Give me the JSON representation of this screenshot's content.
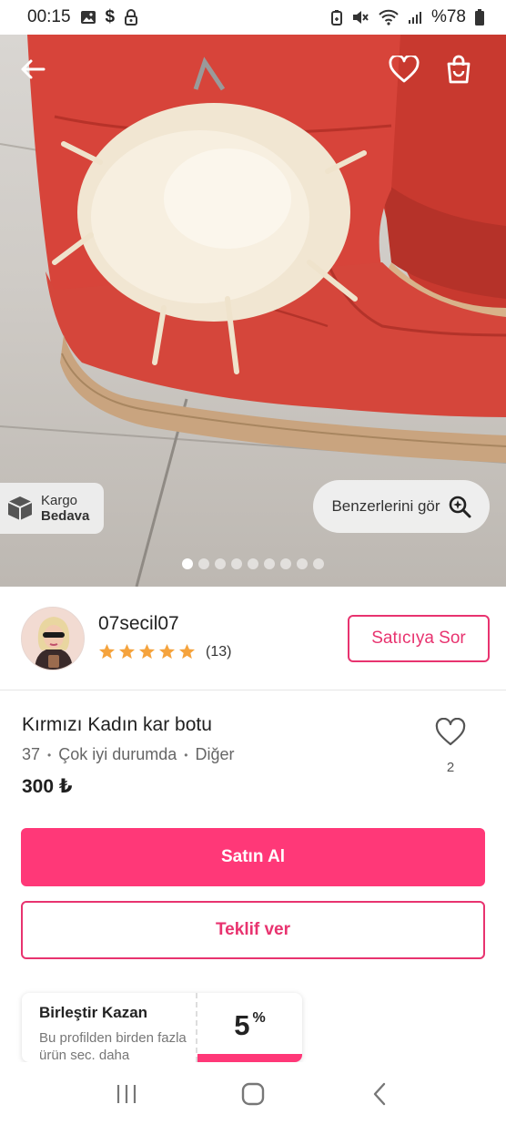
{
  "status_bar": {
    "time": "00:15",
    "battery": "%78",
    "left_icons": [
      "gallery-icon",
      "dollar-icon",
      "lock-icon"
    ],
    "right_icons": [
      "battery-saver-icon",
      "mute-icon",
      "wifi-icon",
      "signal-icon",
      "battery-icon"
    ]
  },
  "hero": {
    "kargo_line1": "Kargo",
    "kargo_line2": "Bedava",
    "similar_label": "Benzerlerini gör",
    "dot_count": 9,
    "active_dot": 0
  },
  "seller": {
    "name": "07secil07",
    "rating": 5,
    "rating_count": "(13)",
    "ask_label": "Satıcıya Sor"
  },
  "product": {
    "title": "Kırmızı Kadın kar botu",
    "size": "37",
    "condition": "Çok iyi durumda",
    "brand": "Diğer",
    "separator": "•",
    "price": "300 ₺",
    "like_count": "2"
  },
  "actions": {
    "buy_label": "Satın Al",
    "offer_label": "Teklif ver"
  },
  "bundle": {
    "title": "Birleştir Kazan",
    "desc": "Bu profilden birden fazla ürün sec. daha",
    "percent": "5",
    "percent_sign": "%"
  },
  "colors": {
    "primary": "#ff3878",
    "primary_text": "#e8336f",
    "star": "#f5a33d"
  }
}
